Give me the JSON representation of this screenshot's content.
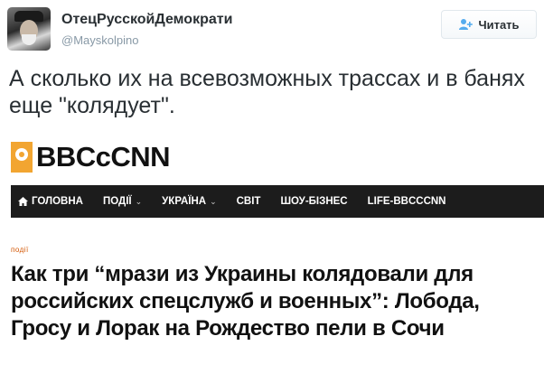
{
  "tweet": {
    "author_name": "ОтецРусскойДемократи",
    "author_handle": "@Mayskolpino",
    "follow_label": "Читать",
    "text": "А сколько их на всевозможных трассах и в банях еще \"колядует\"."
  },
  "article": {
    "site_logo": "BBCcCNN",
    "nav": [
      {
        "label": "ГОЛОВНА",
        "icon": "home-icon"
      },
      {
        "label": "ПОДІЇ",
        "has_dropdown": true
      },
      {
        "label": "УКРАЇНА",
        "has_dropdown": true
      },
      {
        "label": "СВІТ"
      },
      {
        "label": "ШОУ-БІЗНЕС"
      },
      {
        "label": "LIFE-BBCCCNN"
      }
    ],
    "category": "події",
    "headline": "Как три “мрази из Украины колядовали для российских спецслужб и военных”: Лобода, Гросу и Лорак на Рождество пели в Сочи"
  },
  "colors": {
    "nav_background": "#1c1c1c",
    "logo_accent": "#f2a531",
    "category_color": "#d35400",
    "handle_color": "#8899a6"
  }
}
